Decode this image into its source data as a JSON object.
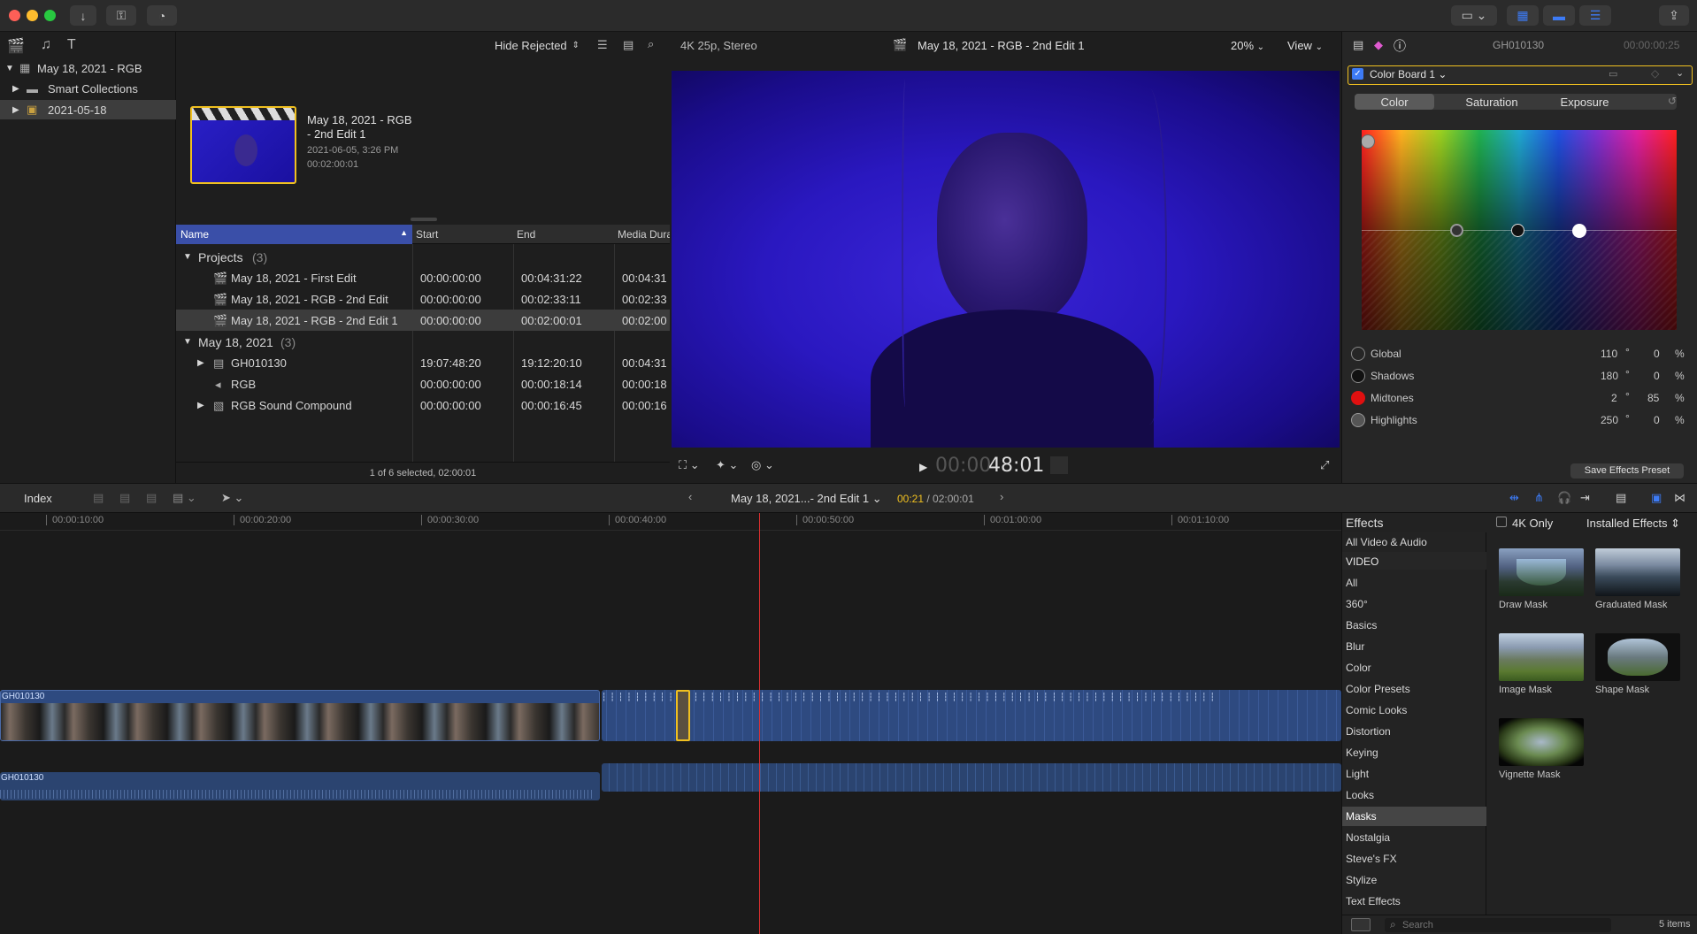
{
  "window": {
    "controls": [
      "close",
      "minimize",
      "zoom"
    ]
  },
  "library": {
    "root": "May 18, 2021 - RGB",
    "items": [
      {
        "label": "Smart Collections"
      },
      {
        "label": "2021-05-18"
      }
    ]
  },
  "browser": {
    "filter_label": "Hide Rejected",
    "clip": {
      "title_line1": "May 18, 2021 - RGB",
      "title_line2": "- 2nd Edit 1",
      "date": "2021-06-05, 3:26 PM",
      "duration": "00:02:00:01"
    },
    "columns": [
      "Name",
      "Start",
      "End",
      "Media Dura"
    ],
    "groups": [
      {
        "label": "Projects",
        "count": "(3)"
      },
      {
        "label": "May 18, 2021",
        "count": "(3)"
      }
    ],
    "rows": [
      {
        "name": "May 18, 2021 - First Edit",
        "start": "00:00:00:00",
        "end": "00:04:31:22",
        "dur": "00:04:31"
      },
      {
        "name": "May 18, 2021 - RGB  - 2nd Edit",
        "start": "00:00:00:00",
        "end": "00:02:33:11",
        "dur": "00:02:33"
      },
      {
        "name": "May 18, 2021 - RGB  - 2nd Edit 1",
        "start": "00:00:00:00",
        "end": "00:02:00:01",
        "dur": "00:02:00"
      },
      {
        "name": "GH010130",
        "start": "19:07:48:20",
        "end": "19:12:20:10",
        "dur": "00:04:31"
      },
      {
        "name": "RGB",
        "start": "00:00:00:00",
        "end": "00:00:18:14",
        "dur": "00:00:18"
      },
      {
        "name": "RGB Sound Compound",
        "start": "00:00:00:00",
        "end": "00:00:16:45",
        "dur": "00:00:16"
      }
    ],
    "status": "1 of 6 selected, 02:00:01"
  },
  "viewer": {
    "format": "4K 25p, Stereo",
    "title": "May 18, 2021 - RGB  - 2nd Edit 1",
    "zoom": "20%",
    "view_label": "View",
    "timecode_dim": "00:00",
    "timecode_bright": "48:01"
  },
  "inspector": {
    "clip_name": "GH010130",
    "clip_tc": "00:00:00:25",
    "effect_name": "Color Board 1",
    "tabs": [
      "Color",
      "Saturation",
      "Exposure"
    ],
    "params": [
      {
        "label": "Global",
        "angle": "110",
        "pct": "0",
        "unit": "%",
        "swatch": "#2a2a2a"
      },
      {
        "label": "Shadows",
        "angle": "180",
        "pct": "0",
        "unit": "%",
        "swatch": "#111111"
      },
      {
        "label": "Midtones",
        "angle": "2",
        "pct": "85",
        "unit": "%",
        "swatch": "#e01010"
      },
      {
        "label": "Highlights",
        "angle": "250",
        "pct": "0",
        "unit": "%",
        "swatch": "#3a3a3a"
      }
    ],
    "deg": "°",
    "save_preset": "Save Effects Preset"
  },
  "timeline_toolbar": {
    "index_label": "Index",
    "project_title": "May 18, 2021...- 2nd Edit 1",
    "position": "00:21",
    "duration": "/ 02:00:01"
  },
  "ruler": [
    "00:00:10:00",
    "00:00:20:00",
    "00:00:30:00",
    "00:00:40:00",
    "00:00:50:00",
    "00:01:00:00",
    "00:01:10:00"
  ],
  "tracks": {
    "video_label": "GH010130",
    "audio_label": "GH010130"
  },
  "effects": {
    "header": "Effects",
    "fourk_label": "4K Only",
    "installed_label": "Installed Effects",
    "categories": [
      "All Video & Audio",
      "VIDEO",
      "All",
      "360°",
      "Basics",
      "Blur",
      "Color",
      "Color Presets",
      "Comic Looks",
      "Distortion",
      "Keying",
      "Light",
      "Looks",
      "Masks",
      "Nostalgia",
      "Steve's FX",
      "Stylize",
      "Text Effects"
    ],
    "items": [
      {
        "label": "Draw Mask"
      },
      {
        "label": "Graduated Mask"
      },
      {
        "label": "Image Mask"
      },
      {
        "label": "Shape Mask"
      },
      {
        "label": "Vignette Mask"
      }
    ],
    "search_placeholder": "Search",
    "count": "5 items"
  }
}
